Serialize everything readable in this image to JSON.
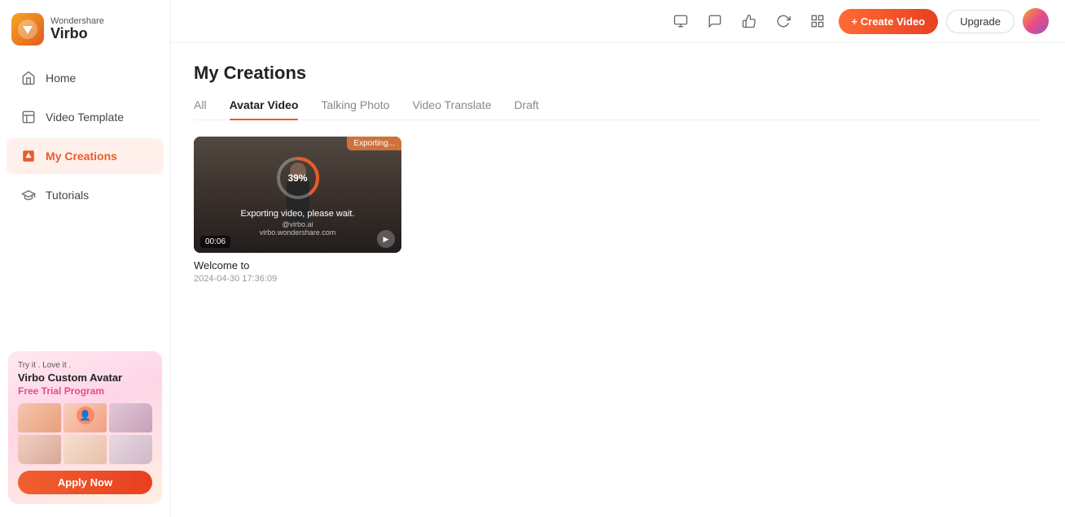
{
  "logo": {
    "brand": "Wondershare",
    "name": "Virbo"
  },
  "sidebar": {
    "items": [
      {
        "id": "home",
        "label": "Home",
        "icon": "home-icon"
      },
      {
        "id": "video-template",
        "label": "Video Template",
        "icon": "template-icon"
      },
      {
        "id": "my-creations",
        "label": "My Creations",
        "icon": "creations-icon",
        "active": true
      },
      {
        "id": "tutorials",
        "label": "Tutorials",
        "icon": "tutorials-icon"
      }
    ]
  },
  "promo": {
    "try_label": "Try it . Love it .",
    "title": "Virbo Custom Avatar",
    "subtitle": "Free Trial Program",
    "apply_label": "Apply Now"
  },
  "topbar": {
    "icons": [
      "screen-icon",
      "chat-icon",
      "like-icon",
      "refresh-icon",
      "grid-icon"
    ],
    "create_btn": "+ Create Video",
    "upgrade_btn": "Upgrade"
  },
  "page": {
    "title": "My Creations",
    "tabs": [
      {
        "id": "all",
        "label": "All",
        "active": false
      },
      {
        "id": "avatar-video",
        "label": "Avatar Video",
        "active": true
      },
      {
        "id": "talking-photo",
        "label": "Talking Photo",
        "active": false
      },
      {
        "id": "video-translate",
        "label": "Video Translate",
        "active": false
      },
      {
        "id": "draft",
        "label": "Draft",
        "active": false
      }
    ]
  },
  "videos": [
    {
      "id": "v1",
      "title": "Welcome to",
      "date": "2024-04-30 17:36:09",
      "duration": "00:06",
      "export_status": "Exporting...",
      "progress": 39,
      "export_msg": "Exporting video, please wait."
    }
  ]
}
